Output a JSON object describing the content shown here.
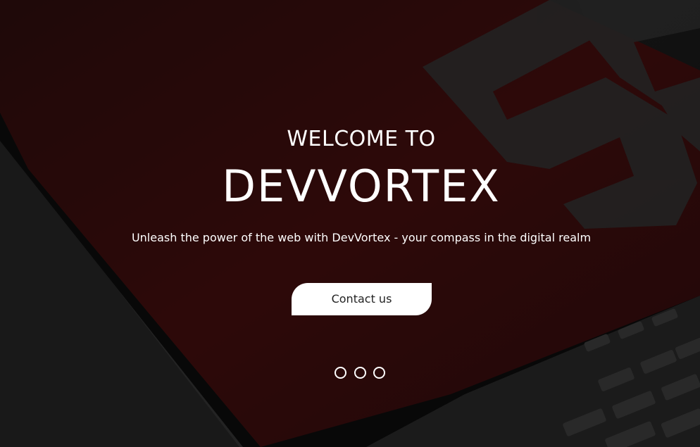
{
  "hero": {
    "welcome": "WELCOME TO",
    "brand": "DEVVORTEX",
    "tagline": "Unleash the power of the web with DevVortex - your compass in the digital realm",
    "cta_label": "Contact us"
  },
  "carousel": {
    "slide_count": 3
  },
  "colors": {
    "background": "#161616",
    "accent_red": "#3a0a0a",
    "text": "#ffffff",
    "button_bg": "#ffffff",
    "button_text": "#222222"
  }
}
